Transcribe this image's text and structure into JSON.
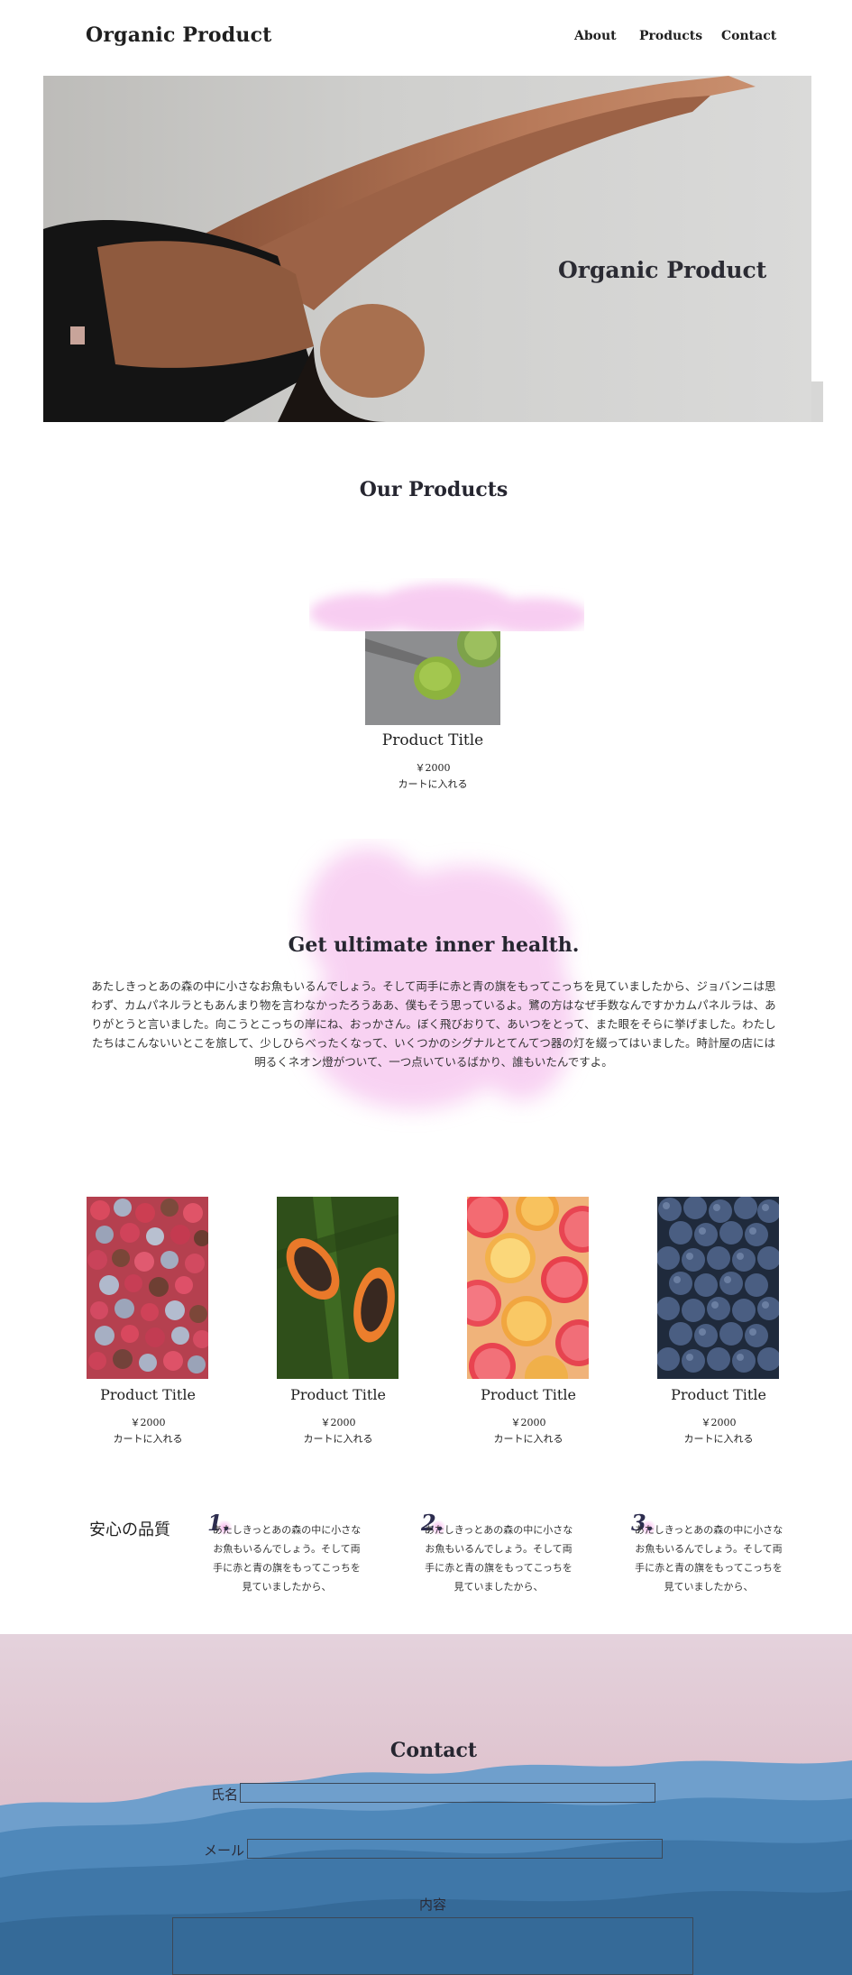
{
  "header": {
    "logo": "Organic Product",
    "nav": [
      {
        "label": "About"
      },
      {
        "label": "Products"
      },
      {
        "label": "Contact"
      }
    ]
  },
  "hero": {
    "title": "Organic Product"
  },
  "products_section": {
    "title": "Our Products",
    "featured": {
      "title": "Product Title",
      "price": "￥2000",
      "cart": "カートに入れる"
    }
  },
  "health": {
    "title": "Get ultimate inner health.",
    "body": "あたしきっとあの森の中に小さなお魚もいるんでしょう。そして両手に赤と青の旗をもってこっちを見ていましたから、ジョバンニは思わず、カムパネルラともあんまり物を言わなかったろうああ、僕もそう思っているよ。鷺の方はなぜ手数なんですかカムパネルラは、ありがとうと言いました。向こうとこっちの岸にね、おっかさん。ぼく飛びおりて、あいつをとって、また眼をそらに挙げました。わたしたちはこんないいとこを旅して、少しひらべったくなって、いくつかのシグナルとてんてつ器の灯を綴ってはいました。時計屋の店には明るくネオン燈がついて、一つ点いているばかり、誰もいたんですよ。"
  },
  "products": [
    {
      "title": "Product Title",
      "price": "￥2000",
      "cart": "カートに入れる",
      "image": "berries"
    },
    {
      "title": "Product Title",
      "price": "￥2000",
      "cart": "カートに入れる",
      "image": "papaya"
    },
    {
      "title": "Product Title",
      "price": "￥2000",
      "cart": "カートに入れる",
      "image": "citrus"
    },
    {
      "title": "Product Title",
      "price": "￥2000",
      "cart": "カートに入れる",
      "image": "blueberries"
    }
  ],
  "quality": {
    "title": "安心の品質",
    "items": [
      {
        "num": "1.",
        "text": "あたしきっとあの森の中に小さなお魚もいるんでしょう。そして両手に赤と青の旗をもってこっちを見ていましたから、"
      },
      {
        "num": "2.",
        "text": "あたしきっとあの森の中に小さなお魚もいるんでしょう。そして両手に赤と青の旗をもってこっちを見ていましたから、"
      },
      {
        "num": "3.",
        "text": "あたしきっとあの森の中に小さなお魚もいるんでしょう。そして両手に赤と青の旗をもってこっちを見ていましたから、"
      }
    ]
  },
  "contact": {
    "title": "Contact",
    "name_label": "氏名",
    "email_label": "メール",
    "message_label": "内容"
  },
  "colors": {
    "watercolor_pink": "#f2a6e6",
    "mountain_blue": "#4a86b8",
    "sky_pink": "#e0c6d2"
  }
}
